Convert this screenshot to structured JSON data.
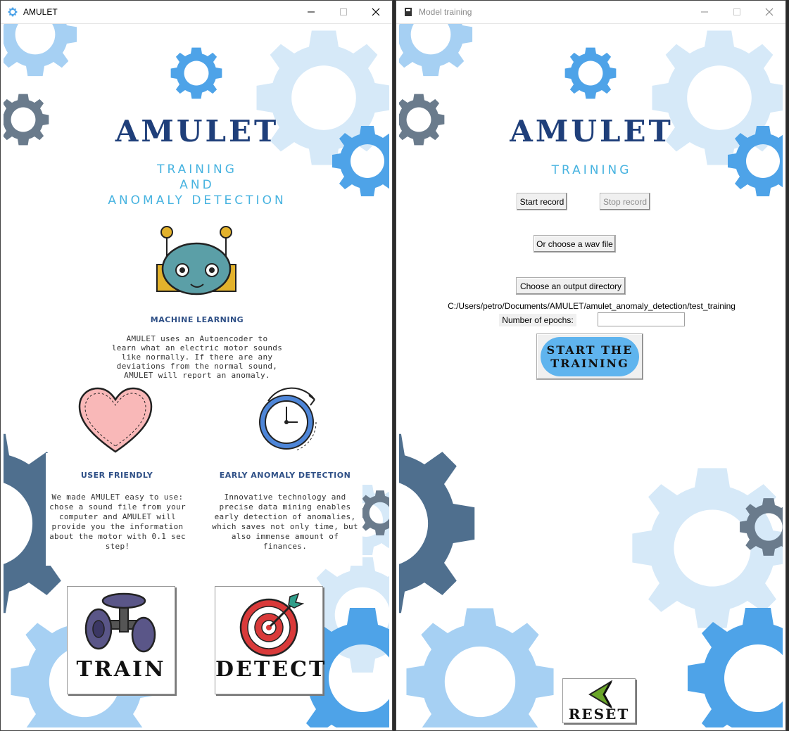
{
  "main_window": {
    "title": "AMULET",
    "brand": "AMULET",
    "subtitle_lines": [
      "TRAINING",
      "AND",
      "ANOMALY DETECTION"
    ],
    "features": {
      "ml": {
        "title": "MACHINE LEARNING",
        "body_lines": [
          "AMULET uses an Autoencoder to",
          "learn what an electric motor sounds",
          "like normally. If there are any",
          "deviations from the normal sound,",
          "AMULET will report an anomaly."
        ]
      },
      "user_friendly": {
        "title": "USER FRIENDLY",
        "body_lines": [
          "We made AMULET easy to use:",
          "chose a sound file from your",
          "computer and AMULET will",
          "provide you the information",
          "about the motor with 0.1 sec",
          "step!"
        ]
      },
      "early": {
        "title": "EARLY ANOMALY DETECTION",
        "body_lines": [
          "Innovative technology and",
          "precise data mining enables",
          "early detection of anomalies,",
          "which saves not only time, but",
          "also immense amount of",
          "finances."
        ]
      }
    },
    "train_label": "TRAIN",
    "detect_label": "DETECT"
  },
  "training_window": {
    "title": "Model training",
    "brand": "AMULET",
    "subtitle": "TRAINING",
    "start_record_label": "Start record",
    "stop_record_label": "Stop record",
    "choose_wav_label": "Or choose a wav file",
    "choose_output_label": "Choose an output directory",
    "output_path": "C:/Users/petro/Documents/AMULET/amulet_anomaly_detection/test_training",
    "epochs_label": "Number of epochs:",
    "epochs_value": "",
    "start_training_lines": [
      "START THE",
      "TRAINING"
    ],
    "reset_label": "RESET"
  },
  "colors": {
    "gear_light": "#d6e9f8",
    "gear_mid": "#a6d0f3",
    "gear_blue": "#4ea3e8",
    "gear_dark": "#4f6f8e",
    "gear_gray": "#6a7b8c",
    "brand_navy": "#1f3f7a",
    "subtitle_cyan": "#47b3e0"
  },
  "icons": [
    "app-gear-icon",
    "minimize-icon",
    "maximize-icon",
    "close-icon",
    "robot-icon",
    "heart-icon",
    "clock-icon",
    "dumbbell-icon",
    "target-icon",
    "back-arrow-icon"
  ]
}
